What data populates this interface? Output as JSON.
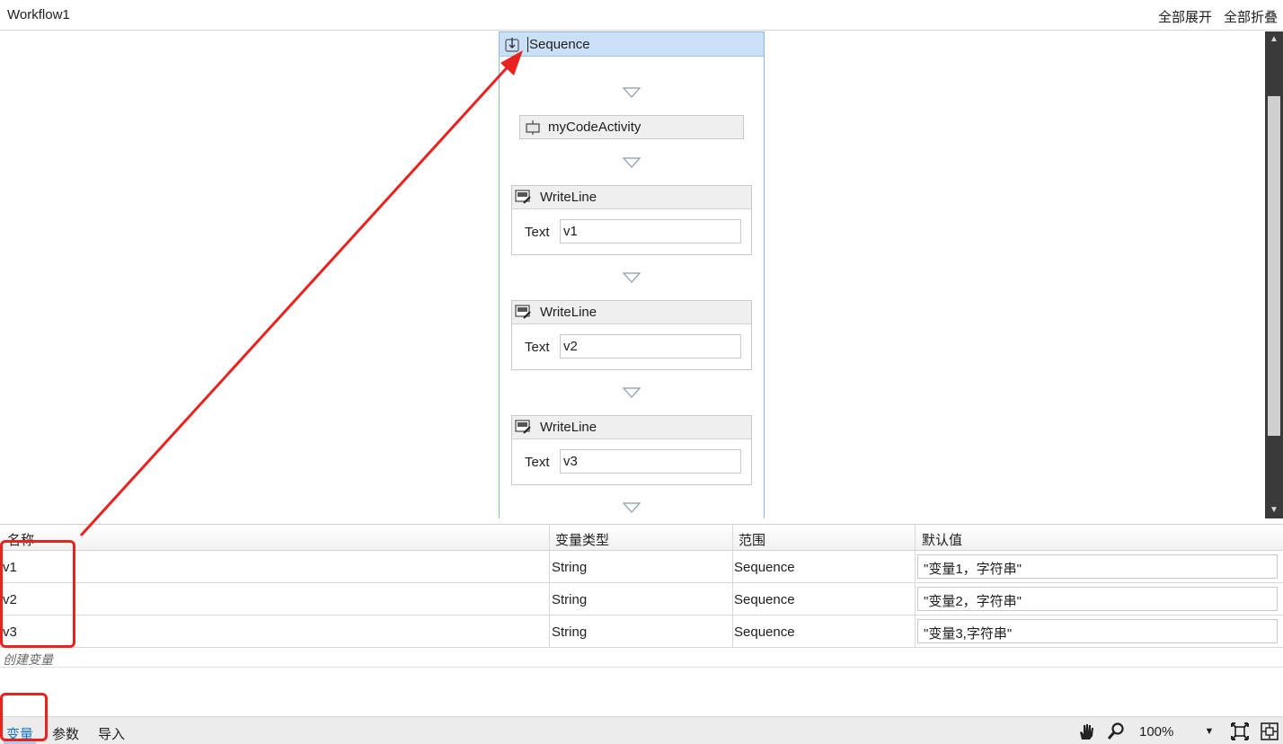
{
  "header": {
    "title": "Workflow1",
    "expand_all": "全部展开",
    "collapse_all": "全部折叠"
  },
  "designer": {
    "sequence_title": "Sequence",
    "code_activity": "myCodeActivity",
    "write_lines": [
      {
        "title": "WriteLine",
        "text_label": "Text",
        "text_value": "v1"
      },
      {
        "title": "WriteLine",
        "text_label": "Text",
        "text_value": "v2"
      },
      {
        "title": "WriteLine",
        "text_label": "Text",
        "text_value": "v3"
      }
    ]
  },
  "variables": {
    "columns": [
      "名称",
      "变量类型",
      "范围",
      "默认值"
    ],
    "rows": [
      {
        "name": "v1",
        "type": "String",
        "scope": "Sequence",
        "default": "\"变量1，字符串\""
      },
      {
        "name": "v2",
        "type": "String",
        "scope": "Sequence",
        "default": "\"变量2，字符串\""
      },
      {
        "name": "v3",
        "type": "String",
        "scope": "Sequence",
        "default": "\"变量3,字符串\""
      }
    ],
    "create_placeholder": "创建变量"
  },
  "bottombar": {
    "tabs": [
      "变量",
      "参数",
      "导入"
    ],
    "active_tab": "变量",
    "zoom": "100%",
    "icons": [
      "hand-icon",
      "zoom-icon",
      "fit-icon",
      "overview-icon"
    ]
  },
  "colors": {
    "sequence_header": "#c9e0f8",
    "sequence_border": "#8fb6e6",
    "annotation_red": "#e8231f",
    "active_tab": "#1a73c9",
    "scrollbar": "#3a3a3a"
  }
}
